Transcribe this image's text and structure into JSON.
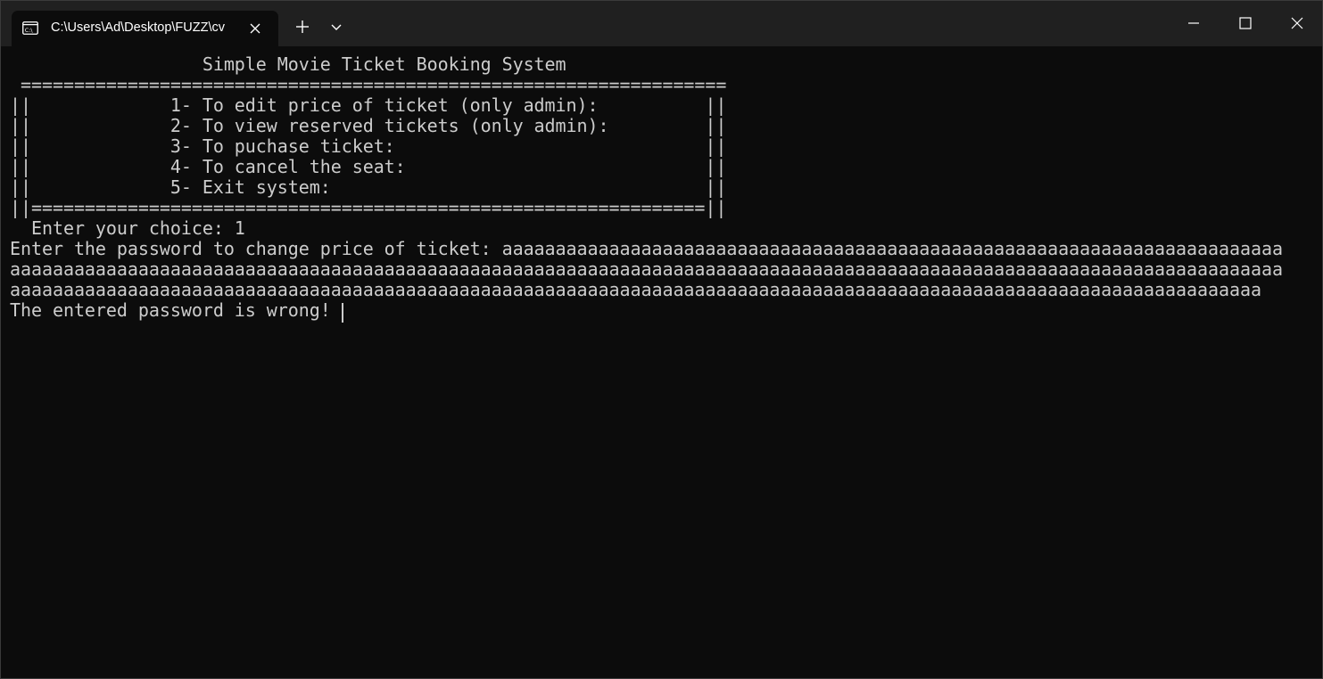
{
  "window": {
    "tab_title": "C:\\Users\\Ad\\Desktop\\FUZZ\\cv"
  },
  "terminal": {
    "lines": [
      "                  Simple Movie Ticket Booking System",
      " ==================================================================",
      "||             1- To edit price of ticket (only admin):          ||",
      "||             2- To view reserved tickets (only admin):         ||",
      "||             3- To puchase ticket:                             ||",
      "||             4- To cancel the seat:                            ||",
      "||             5- Exit system:                                   ||",
      "||===============================================================||",
      "  Enter your choice: 1",
      "Enter the password to change price of ticket: aaaaaaaaaaaaaaaaaaaaaaaaaaaaaaaaaaaaaaaaaaaaaaaaaaaaaaaaaaaaaaaaaaaaaaaaa",
      "aaaaaaaaaaaaaaaaaaaaaaaaaaaaaaaaaaaaaaaaaaaaaaaaaaaaaaaaaaaaaaaaaaaaaaaaaaaaaaaaaaaaaaaaaaaaaaaaaaaaaaaaaaaaaaaaaaaaaaa",
      "aaaaaaaaaaaaaaaaaaaaaaaaaaaaaaaaaaaaaaaaaaaaaaaaaaaaaaaaaaaaaaaaaaaaaaaaaaaaaaaaaaaaaaaaaaaaaaaaaaaaaaaaaaaaaaaaaaaaa",
      "The entered password is wrong! "
    ]
  },
  "colors": {
    "terminal_bg": "#0c0c0c",
    "titlebar_bg": "#202020",
    "text": "#cccccc"
  },
  "icons": {
    "tab": "terminal-icon",
    "close_tab": "close-icon",
    "new_tab": "plus-icon",
    "dropdown": "chevron-down-icon",
    "minimize": "minimize-icon",
    "maximize": "maximize-icon",
    "close_window": "close-icon"
  }
}
